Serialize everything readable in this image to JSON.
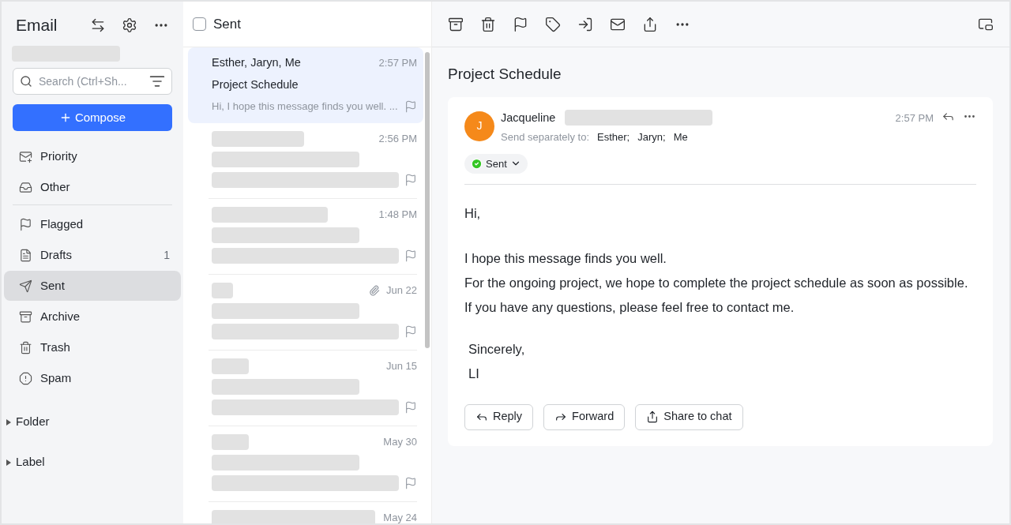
{
  "sidebar": {
    "title": "Email",
    "search": {
      "placeholder": "Search (Ctrl+Sh..."
    },
    "compose": "Compose",
    "groups": [
      [
        {
          "kind": "priority",
          "label": "Priority",
          "selected": false
        },
        {
          "kind": "other",
          "label": "Other",
          "selected": false
        }
      ],
      [
        {
          "kind": "flagged",
          "label": "Flagged",
          "selected": false
        },
        {
          "kind": "drafts",
          "label": "Drafts",
          "count": "1",
          "selected": false
        },
        {
          "kind": "sent",
          "label": "Sent",
          "selected": true
        },
        {
          "kind": "archive",
          "label": "Archive",
          "selected": false
        },
        {
          "kind": "trash",
          "label": "Trash",
          "selected": false
        },
        {
          "kind": "spam",
          "label": "Spam",
          "selected": false
        }
      ]
    ],
    "sections": [
      {
        "label": "Folder",
        "expanded": false
      },
      {
        "label": "Label",
        "expanded": false
      }
    ]
  },
  "list": {
    "title": "Sent",
    "checked": false,
    "messages": [
      {
        "from": "Esther, Jaryn, Me",
        "time": "2:57 PM",
        "subject": "Project Schedule",
        "preview": "Hi, I hope this message finds you well. ...",
        "selected": true,
        "attachment": false
      },
      {
        "time": "2:56 PM",
        "selected": false,
        "attachment": false
      },
      {
        "time": "1:48 PM",
        "selected": false,
        "attachment": false
      },
      {
        "time": "Jun 22",
        "selected": false,
        "attachment": true
      },
      {
        "time": "Jun 15",
        "selected": false,
        "attachment": false
      },
      {
        "time": "May 30",
        "selected": false,
        "attachment": false
      },
      {
        "time": "May 24",
        "selected": false,
        "attachment": false
      }
    ]
  },
  "reader": {
    "title": "Project Schedule",
    "message": {
      "avatar": "J",
      "sender": "Jacqueline",
      "time": "2:57 PM",
      "to_label": "Send separately to:",
      "recipients": [
        "Esther;",
        "Jaryn;",
        "Me"
      ],
      "status": "Sent",
      "body": [
        "Hi,",
        "I hope this message finds you well.",
        "For the ongoing project, we hope to complete the project schedule as soon as possible.",
        "If you have any questions, please feel free to contact me."
      ],
      "signature": [
        "Sincerely,",
        "LI"
      ]
    },
    "actions": [
      "Reply",
      "Forward",
      "Share to chat"
    ]
  }
}
